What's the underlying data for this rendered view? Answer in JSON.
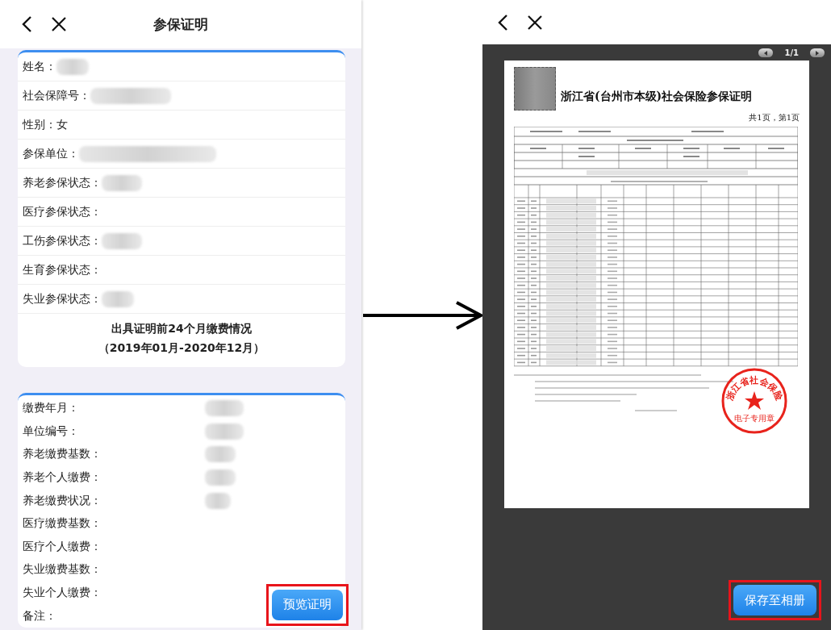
{
  "left_screen": {
    "title": "参保证明",
    "info_rows": [
      {
        "label": "姓名：",
        "blurred": true
      },
      {
        "label": "社会保障号：",
        "blurred": true
      },
      {
        "label": "性别：",
        "value": "女",
        "blurred": false
      },
      {
        "label": "参保单位：",
        "blurred": true
      },
      {
        "label": "养老参保状态：",
        "blurred": true
      },
      {
        "label": "医疗参保状态：",
        "blurred": false
      },
      {
        "label": "工伤参保状态：",
        "blurred": true
      },
      {
        "label": "生育参保状态：",
        "blurred": false
      },
      {
        "label": "失业参保状态：",
        "blurred": true
      }
    ],
    "summary_heading": [
      "出具证明前24个月缴费情况",
      "（2019年01月-2020年12月）"
    ],
    "payment_rows": [
      {
        "label": "缴费年月：",
        "blurred": true
      },
      {
        "label": "单位编号：",
        "blurred": true
      },
      {
        "label": "养老缴费基数：",
        "blurred": true
      },
      {
        "label": "养老个人缴费：",
        "blurred": true
      },
      {
        "label": "养老缴费状况：",
        "blurred": true
      },
      {
        "label": "医疗缴费基数：",
        "blurred": false
      },
      {
        "label": "医疗个人缴费：",
        "blurred": false
      },
      {
        "label": "失业缴费基数：",
        "blurred": false
      },
      {
        "label": "失业个人缴费：",
        "blurred": false
      },
      {
        "label": "备注：",
        "blurred": false
      }
    ],
    "preview_button": {
      "label": "预览证明",
      "highlighted": true
    }
  },
  "right_screen": {
    "page_indicator": "1/1",
    "document": {
      "title": "浙江省(台州市本级)社会保险参保证明",
      "page_count": "共1页，第1页",
      "stamp": {
        "ring_text": "浙江省社会保险",
        "center_text": "电子专用章"
      }
    },
    "save_button": {
      "label": "保存至相册",
      "highlighted": true
    }
  }
}
